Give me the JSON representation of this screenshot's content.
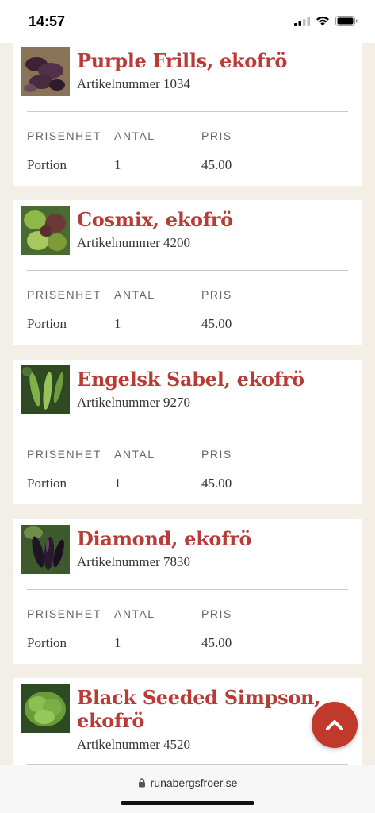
{
  "status": {
    "time": "14:57"
  },
  "table_headers": {
    "unit": "PRISENHET",
    "qty": "ANTAL",
    "price": "PRIS"
  },
  "products": [
    {
      "name": "Purple Frills, ekofrö",
      "article": "Artikelnummer 1034",
      "unit": "Portion",
      "qty": "1",
      "price": "45.00",
      "image": "purple-frills-image"
    },
    {
      "name": "Cosmix, ekofrö",
      "article": "Artikelnummer 4200",
      "unit": "Portion",
      "qty": "1",
      "price": "45.00",
      "image": "cosmix-lettuce-image"
    },
    {
      "name": "Engelsk Sabel, ekofrö",
      "article": "Artikelnummer 9270",
      "unit": "Portion",
      "qty": "1",
      "price": "45.00",
      "image": "pea-pods-image"
    },
    {
      "name": "Diamond, ekofrö",
      "article": "Artikelnummer 7830",
      "unit": "Portion",
      "qty": "1",
      "price": "45.00",
      "image": "eggplant-image"
    },
    {
      "name": "Black Seeded Simpson, ekofrö",
      "article": "Artikelnummer 4520",
      "image": "green-lettuce-image"
    }
  ],
  "browser": {
    "url": "runabergsfroer.se"
  },
  "colors": {
    "accent": "#b83b36",
    "fab": "#c0392b",
    "background": "#f3efe6"
  },
  "icons": {
    "fab": "chevron-up-icon",
    "lock": "lock-icon"
  }
}
